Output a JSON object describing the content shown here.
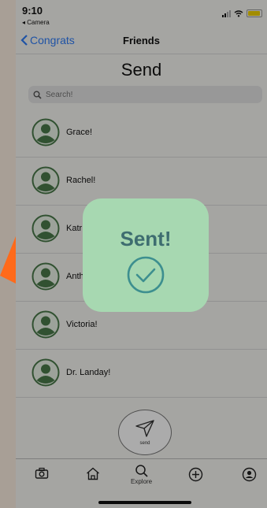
{
  "status": {
    "time": "9:10",
    "back_app": "◂ Camera"
  },
  "nav": {
    "back_label": "Congrats",
    "title": "Friends"
  },
  "page": {
    "title": "Send"
  },
  "search": {
    "placeholder": "Search!"
  },
  "friends": [
    "Grace!",
    "Rachel!",
    "Katr",
    "Anth",
    "Victoria!",
    "Dr. Landay!"
  ],
  "send_button": {
    "label": "send"
  },
  "tabs": {
    "explore_label": "Explore"
  },
  "toast": {
    "title": "Sent!"
  },
  "colors": {
    "accent": "#2f7cf6",
    "toast_bg": "#a7d8b1",
    "toast_text": "#3e6d70",
    "arrow": "#ff6a1a",
    "background": "#fbeee0"
  }
}
